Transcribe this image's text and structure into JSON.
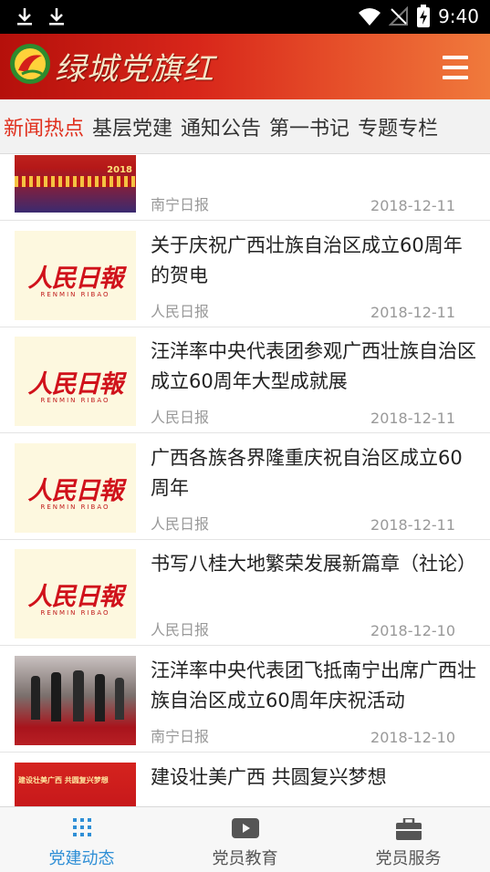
{
  "status_bar": {
    "time": "9:40"
  },
  "app": {
    "title": "绿城党旗红"
  },
  "tabs": [
    {
      "label": "新闻热点",
      "active": true
    },
    {
      "label": "基层党建",
      "active": false
    },
    {
      "label": "通知公告",
      "active": false
    },
    {
      "label": "第一书记",
      "active": false
    },
    {
      "label": "专题专栏",
      "active": false
    }
  ],
  "news": [
    {
      "title": "",
      "source": "南宁日报",
      "date": "2018-12-11",
      "thumb_text": "2018"
    },
    {
      "title": "关于庆祝广西壮族自治区成立60周年的贺电",
      "source": "人民日报",
      "date": "2018-12-11",
      "thumb_logo": "人民日報",
      "thumb_sub": "RENMIN RIBAO"
    },
    {
      "title": "汪洋率中央代表团参观广西壮族自治区成立60周年大型成就展",
      "source": "人民日报",
      "date": "2018-12-11",
      "thumb_logo": "人民日報",
      "thumb_sub": "RENMIN RIBAO"
    },
    {
      "title": "广西各族各界隆重庆祝自治区成立60周年",
      "source": "人民日报",
      "date": "2018-12-11",
      "thumb_logo": "人民日報",
      "thumb_sub": "RENMIN RIBAO"
    },
    {
      "title": "书写八桂大地繁荣发展新篇章（社论）",
      "source": "人民日报",
      "date": "2018-12-10",
      "thumb_logo": "人民日報",
      "thumb_sub": "RENMIN RIBAO"
    },
    {
      "title": "汪洋率中央代表团飞抵南宁出席广西壮族自治区成立60周年庆祝活动",
      "source": "南宁日报",
      "date": "2018-12-10"
    },
    {
      "title": "建设壮美广西 共圆复兴梦想",
      "source": "",
      "date": "",
      "thumb_text": "建设壮美广西 共圆复兴梦想"
    }
  ],
  "bottom_nav": [
    {
      "label": "党建动态",
      "icon": "grid-icon",
      "active": true
    },
    {
      "label": "党员教育",
      "icon": "video-play-icon",
      "active": false
    },
    {
      "label": "党员服务",
      "icon": "briefcase-icon",
      "active": false
    }
  ],
  "colors": {
    "accent": "#e0301e",
    "nav_active": "#2f8fd6",
    "app_bar": "#c8190f"
  }
}
